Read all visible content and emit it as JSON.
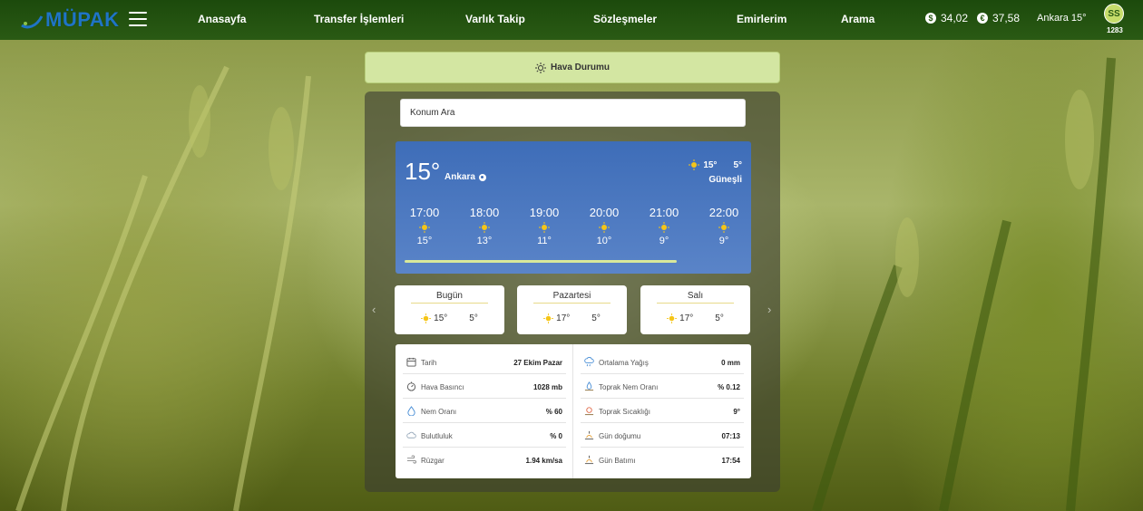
{
  "app": {
    "logo_text": "MÜPAK"
  },
  "nav": {
    "items": [
      {
        "label": "Anasayfa"
      },
      {
        "label": "Transfer İşlemleri"
      },
      {
        "label": "Varlık Takip"
      },
      {
        "label": "Sözleşmeler"
      },
      {
        "label": "Emirlerim"
      },
      {
        "label": "Arama"
      }
    ],
    "usd": "34,02",
    "eur": "37,58",
    "city_temp": "Ankara 15°",
    "avatar_initials": "SS",
    "user_id": "1283"
  },
  "weather": {
    "header_title": "Hava Durumu",
    "search_placeholder": "Konum Ara",
    "current": {
      "temp": "15°",
      "city": "Ankara",
      "high": "15°",
      "low": "5°",
      "condition": "Güneşli"
    },
    "hourly": [
      {
        "time": "17:00",
        "temp": "15°"
      },
      {
        "time": "18:00",
        "temp": "13°"
      },
      {
        "time": "19:00",
        "temp": "11°"
      },
      {
        "time": "20:00",
        "temp": "10°"
      },
      {
        "time": "21:00",
        "temp": "9°"
      },
      {
        "time": "22:00",
        "temp": "9°"
      }
    ],
    "daily": [
      {
        "day": "Bugün",
        "high": "15°",
        "low": "5°"
      },
      {
        "day": "Pazartesi",
        "high": "17°",
        "low": "5°"
      },
      {
        "day": "Salı",
        "high": "17°",
        "low": "5°"
      }
    ],
    "details_left": [
      {
        "icon": "calendar-icon",
        "label": "Tarih",
        "value": "27 Ekim Pazar"
      },
      {
        "icon": "pressure-icon",
        "label": "Hava Basıncı",
        "value": "1028 mb"
      },
      {
        "icon": "humidity-icon",
        "label": "Nem Oranı",
        "value": "% 60"
      },
      {
        "icon": "cloud-icon",
        "label": "Bulutluluk",
        "value": "% 0"
      },
      {
        "icon": "wind-icon",
        "label": "Rüzgar",
        "value": "1.94 km/sa"
      }
    ],
    "details_right": [
      {
        "icon": "rain-icon",
        "label": "Ortalama Yağış",
        "value": "0 mm"
      },
      {
        "icon": "soil-moisture-icon",
        "label": "Toprak Nem Oranı",
        "value": "% 0.12"
      },
      {
        "icon": "soil-temperature-icon",
        "label": "Toprak Sıcaklığı",
        "value": "9°"
      },
      {
        "icon": "sunrise-icon",
        "label": "Gün doğumu",
        "value": "07:13"
      },
      {
        "icon": "sunset-icon",
        "label": "Gün Batımı",
        "value": "17:54"
      }
    ]
  },
  "colors": {
    "topbar": "#2a5a14",
    "accent_green": "#d3e6a2",
    "weather_blue": "#3e6db8",
    "sun_yellow": "#f5c518"
  }
}
